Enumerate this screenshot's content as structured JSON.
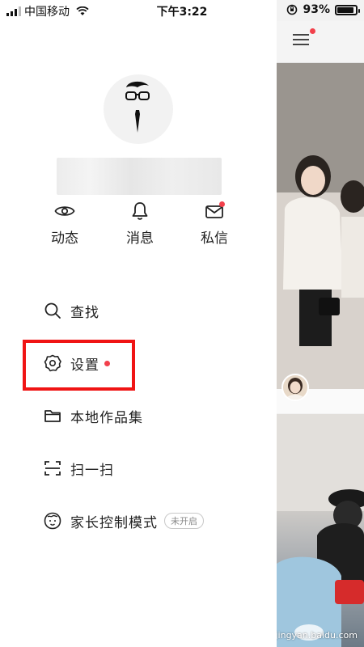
{
  "status_bar": {
    "carrier": "中国移动",
    "time": "下午3:22",
    "battery_percent": "93%",
    "battery_level": 0.93,
    "icons": [
      "signal-icon",
      "wifi-icon",
      "orientation-lock-icon",
      "battery-icon"
    ]
  },
  "profile": {
    "avatar_icon": "avatar-glasses-tie-icon"
  },
  "quick_actions": [
    {
      "label": "动态",
      "icon": "eye-icon"
    },
    {
      "label": "消息",
      "icon": "bell-icon"
    },
    {
      "label": "私信",
      "icon": "mail-icon"
    }
  ],
  "menu": {
    "search": {
      "label": "查找",
      "icon": "search-icon"
    },
    "settings": {
      "label": "设置",
      "icon": "gear-icon"
    },
    "local_works": {
      "label": "本地作品集",
      "icon": "folder-icon"
    },
    "scan": {
      "label": "扫一扫",
      "icon": "scan-icon"
    },
    "parental": {
      "label": "家长控制模式",
      "icon": "face-icon",
      "badge": "未开启"
    }
  },
  "feed": {
    "menu_icon": "hamburger-menu-icon",
    "watermark": "jingyan.baidu.com"
  },
  "colors": {
    "red_dot": "#f2404b",
    "highlight": "#f01414"
  }
}
